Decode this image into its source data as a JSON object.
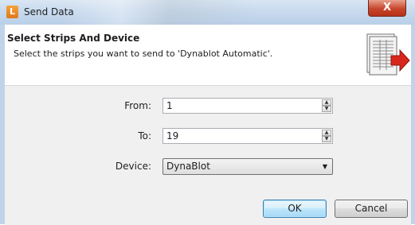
{
  "window": {
    "title": "Send Data",
    "app_icon_letter": "L",
    "close_glyph": "X"
  },
  "header": {
    "title": "Select Strips And Device",
    "subtitle": "Select the strips you want to send to 'Dynablot Automatic'.",
    "graphic_icon": "document-send-icon"
  },
  "form": {
    "from": {
      "label": "From:",
      "value": "1"
    },
    "to": {
      "label": "To:",
      "value": "19"
    },
    "device": {
      "label": "Device:",
      "value": "DynaBlot"
    }
  },
  "buttons": {
    "ok_label": "OK",
    "cancel_label": "Cancel"
  },
  "colors": {
    "accent": "#3c7fb1",
    "close_button": "#c7452c",
    "arrow": "#d9261c"
  }
}
